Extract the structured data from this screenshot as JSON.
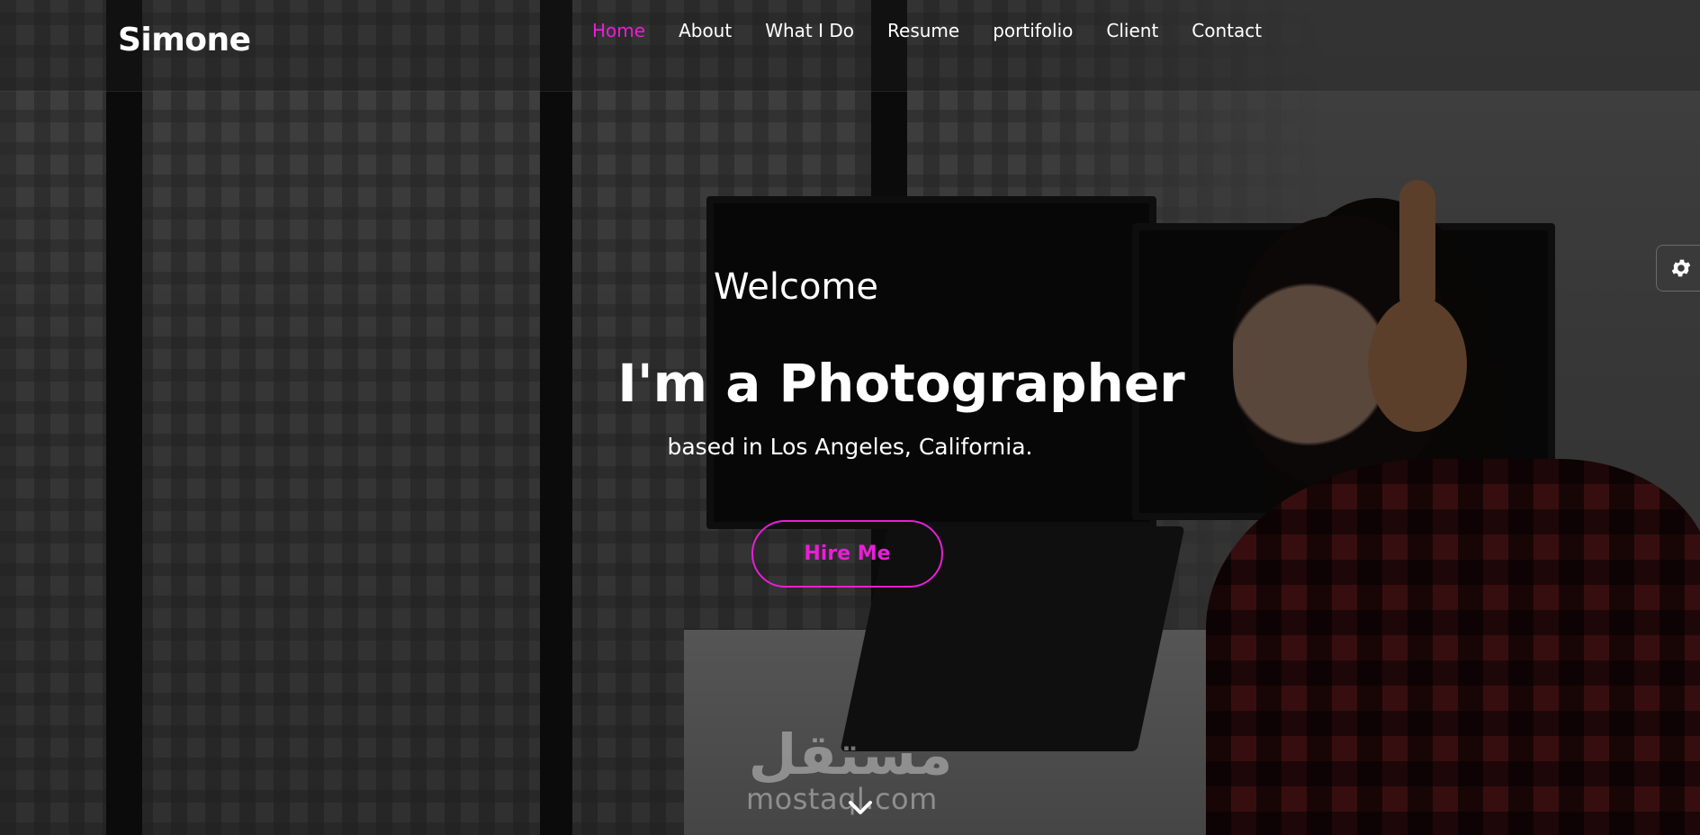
{
  "brand": {
    "logo": "Simone"
  },
  "nav": {
    "items": [
      {
        "label": "Home",
        "active": true
      },
      {
        "label": "About",
        "active": false
      },
      {
        "label": "What I Do",
        "active": false
      },
      {
        "label": "Resume",
        "active": false
      },
      {
        "label": "portifolio",
        "active": false
      },
      {
        "label": "Client",
        "active": false
      },
      {
        "label": "Contact",
        "active": false
      }
    ]
  },
  "hero": {
    "welcome": "Welcome",
    "title": "I'm a Photographer",
    "subtitle": "based in Los Angeles, California.",
    "cta_label": "Hire Me"
  },
  "watermark": {
    "arabic": "مستقل",
    "text": "mostaql.com"
  },
  "icons": {
    "settings": "gear-icon",
    "scroll": "chevron-down-icon"
  },
  "colors": {
    "accent": "#e91ed7",
    "text": "#ffffff"
  }
}
